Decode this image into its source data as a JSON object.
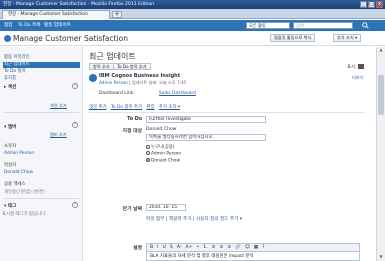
{
  "window": {
    "title": "현장 - Manage Customer Satisfaction - Mozilla Firefox 2011 Edition",
    "controls": [
      "_",
      "□",
      "x"
    ]
  },
  "browser": {
    "tab_label": "현장 - Manage Customer Satisfaction",
    "new_tab": "+"
  },
  "appbar": {
    "nav": [
      "협업",
      "To Do 목록",
      "활동 업데이트"
    ],
    "scope": "모든 활동",
    "search_placeholder": "검색"
  },
  "header": {
    "title": "Manage Customer Satisfaction",
    "btn_copy": "템플릿 활동으로 복사",
    "btn_more": "추가 조치 ▾"
  },
  "sidebar": {
    "items": [
      {
        "label": "활동 아웃라인",
        "active": false
      },
      {
        "label": "최근 업데이트",
        "active": true
      },
      {
        "label": "To Do 항목",
        "active": false
      },
      {
        "label": "휴지통",
        "active": false
      }
    ],
    "section_label": "섹션",
    "add_section": "섹션 추가",
    "members_label": "멤버",
    "add_members": "멤버 추가",
    "owner_label": "소유자",
    "owner_name": "Admin Person",
    "author_label": "작성자",
    "author_name": "Donald Chow",
    "public_label": "공용 액세스",
    "public_value": "개인용(기본값) (변경)",
    "tags_label": "태그",
    "tags_value": "표시할 태그가 없습니다."
  },
  "main": {
    "heading": "최근 업데이트",
    "btn_add_entry": "항목 추가",
    "btn_add_todo": "To Do 항목 추가",
    "view_label": "표시:",
    "more_link": "더보기",
    "app_title": "IBM Cognos Business Insight",
    "app_author": "Admin Person",
    "app_updated": "업데이트 날짜: 오늘 오후 7:45",
    "dashboard_label": "Dashboard Link:",
    "dashboard_link": "Sales Dashboard",
    "sub_links": [
      "댓글 추가",
      "To Do 항목 추가",
      "편집",
      "추가 조치 ▾"
    ],
    "todo_label": "To Do",
    "todo_value": "Further Investigate",
    "assign_label": "지정 대상",
    "assign_value": "Donald Chow",
    "assign_hint": "목록을 필터링하려면 입력하십시오.",
    "radio_options": [
      "누구나(공용)",
      "Admin Person",
      "Donald Chow"
    ],
    "radio_selected": 2,
    "due_label": "만기 날짜",
    "due_value": "2010. 10. 15.",
    "attach_links": [
      "파일 첨부",
      "책갈피 추가",
      "사용자 정의 필드 추가 ▾"
    ],
    "desc_label": "설명",
    "toolbar": [
      "B",
      "I",
      "U",
      "S",
      "A-",
      "A+",
      "•",
      "1.",
      "≡",
      "≡",
      "≡",
      "🔗",
      "☺",
      "▦",
      "?"
    ],
    "desc_value": "BLA 지표들의 자세 분석 및 향후 레실천은 impact 분석"
  }
}
